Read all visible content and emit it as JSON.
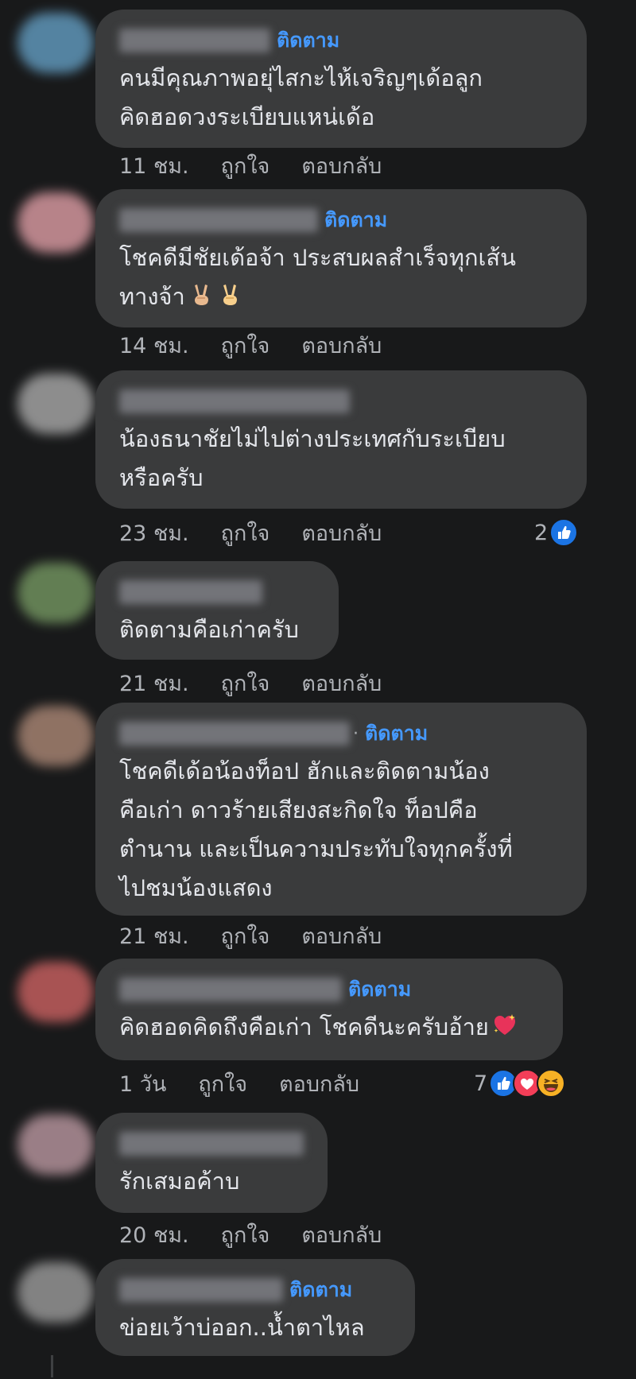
{
  "comments": [
    {
      "has_follow": true,
      "follow_label": "ติดตาม",
      "text": "คนมีคุณภาพอยุ่ไสกะไห้เจริญๆเด้อลูก\nคิดฮอดวงระเบียบแหน่เด้อ",
      "time": "11 ชม.",
      "like_label": "ถูกใจ",
      "reply_label": "ตอบกลับ",
      "avatar_color": "#5b8fb0"
    },
    {
      "has_follow": true,
      "follow_label": "ติดตาม",
      "text": "โชคดีมีชัยเด้อจ้า ประสบผลสำเร็จทุกเส้น\nทางจ้า",
      "emoji": [
        "victory-hand-icon",
        "victory-hand-icon"
      ],
      "time": "14 ชม.",
      "like_label": "ถูกใจ",
      "reply_label": "ตอบกลับ",
      "avatar_color": "#c98f96"
    },
    {
      "has_follow": false,
      "text": "น้องธนาชัยไม่ไปต่างประเทศกับระเบียบ\nหรือครับ",
      "time": "23 ชม.",
      "like_label": "ถูกใจ",
      "reply_label": "ตอบกลับ",
      "reaction_count": "2",
      "reactions": [
        "like-reaction-icon"
      ],
      "avatar_color": "#9a9a9a"
    },
    {
      "has_follow": false,
      "text": "ติดตามคือเก่าครับ",
      "time": "21 ชม.",
      "like_label": "ถูกใจ",
      "reply_label": "ตอบกลับ",
      "avatar_color": "#6b8a5a"
    },
    {
      "has_follow": true,
      "follow_label": "ติดตาม",
      "follow_dot": "·",
      "text": "โชคดีเด้อน้องท็อป ฮักและติดตามน้อง\nคือเก่า ดาวร้ายเสียงสะกิดใจ ท็อปคือ\nตำนาน และเป็นความประทับใจทุกครั้งที่\nไปชมน้องแสดง",
      "time": "21 ชม.",
      "like_label": "ถูกใจ",
      "reply_label": "ตอบกลับ",
      "avatar_color": "#9c7c6c"
    },
    {
      "has_follow": true,
      "follow_label": "ติดตาม",
      "text": "คิดฮอดคิดถึงคือเก่า โชคดีนะครับอ้าย",
      "emoji": [
        "sparkling-heart-icon"
      ],
      "time": "1 วัน",
      "like_label": "ถูกใจ",
      "reply_label": "ตอบกลับ",
      "reaction_count": "7",
      "reactions": [
        "like-reaction-icon",
        "love-reaction-icon",
        "haha-reaction-icon"
      ],
      "avatar_color": "#b85a5a"
    },
    {
      "has_follow": false,
      "text": "รักเสมอค้าบ",
      "time": "20 ชม.",
      "like_label": "ถูกใจ",
      "reply_label": "ตอบกลับ",
      "avatar_color": "#a98a92"
    },
    {
      "has_follow": true,
      "follow_label": "ติดตาม",
      "text": "ข่อยเว้าบ่ออก..น้ำตาไหล",
      "avatar_color": "#8e8e8e"
    }
  ],
  "colors": {
    "background": "#18191a",
    "bubble": "#3a3b3c",
    "follow": "#4599ff",
    "meta_text": "#b0b3b8"
  }
}
